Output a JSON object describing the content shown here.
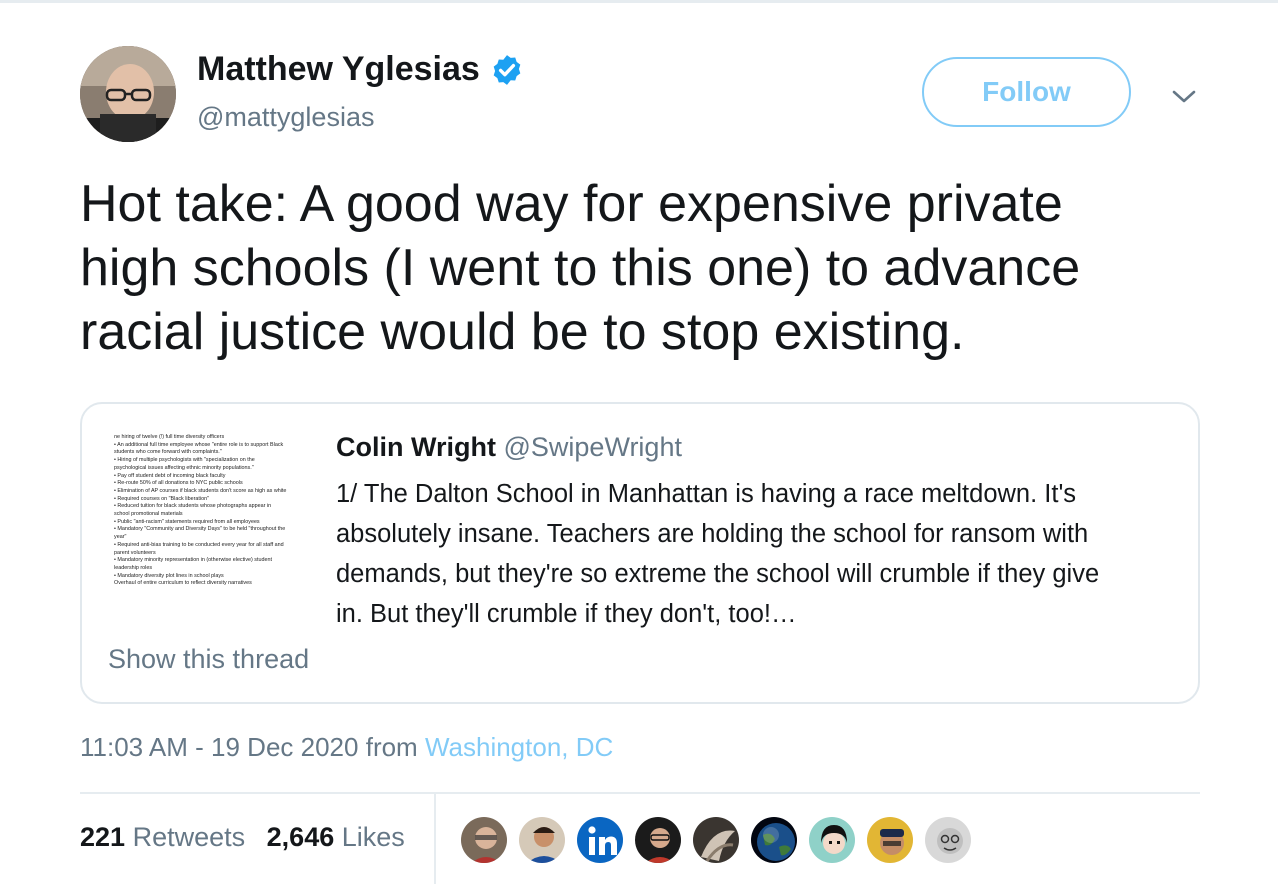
{
  "author": {
    "display_name": "Matthew Yglesias",
    "handle": "@mattyglesias",
    "verified_icon": "verified-badge-icon",
    "avatar_icon": "user-avatar"
  },
  "actions": {
    "follow_label": "Follow",
    "more_icon": "chevron-down-icon"
  },
  "tweet": {
    "lines": [
      "Hot take: A good way for expensive private",
      "high schools (I went to this one) to advance",
      "racial justice would be to stop existing."
    ]
  },
  "quote": {
    "author_name": "Colin Wright",
    "author_handle": "@SwipeWright",
    "lines": [
      "1/ The Dalton School in Manhattan is having a race meltdown. It's",
      "absolutely insane. Teachers are holding the school for ransom with",
      "demands, but they're so extreme the school will crumble if they give",
      "in. But they'll crumble if they don't, too!…"
    ],
    "show_thread": "Show this thread",
    "thumbnail_lines": [
      "he hiring of twelve (!) full time diversity officers",
      "An additional full time employee whose \"entire role is to support Black",
      "students who come forward with complaints.\"",
      "Hiring of multiple psychologists with \"specialization on the",
      "psychological issues affecting ethnic minority populations.\"",
      "Pay off student debt of incoming black faculty",
      "Re-route 50% of all donations to NYC public schools",
      "Elimination of AP courses if black students don't score as high as white",
      "Required courses on \"Black liberation\"",
      "Reduced tuition for black students whose photographs appear in",
      "school promotional materials",
      "Public \"anti-racism\" statements required from all employees",
      "Mandatory \"Community and Diversity Days\" to be held \"throughout the",
      "year\"",
      "Required anti-bias training to be conducted every year for all staff and",
      "parent volunteers",
      "Mandatory minority representation in (otherwise elective) student",
      "leadership roles",
      "Mandatory diversity plot lines in school plays",
      "Overhaul of entire curriculum to reflect diversity narratives"
    ]
  },
  "meta": {
    "timestamp": "11:03 AM - 19 Dec 2020",
    "from_label": "from",
    "location": "Washington, DC"
  },
  "stats": {
    "retweets_count": "221",
    "retweets_label": "Retweets",
    "likes_count": "2,646",
    "likes_label": "Likes"
  },
  "colors": {
    "accent": "#1da1f2",
    "text": "#14171a",
    "secondary": "#657786",
    "border": "#e1e8ed"
  }
}
